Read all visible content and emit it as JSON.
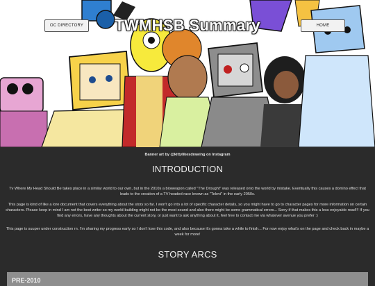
{
  "nav": {
    "oc_directory_label": "OC DIRECTORY",
    "home_label": "HOME"
  },
  "banner": {
    "title": "TWMHSB Summary",
    "credit": "Banner art by @kittylikesdrawing on Instagram"
  },
  "intro": {
    "heading": "INTRODUCTION",
    "paragraphs": [
      "Tv Where My Head Should Be takes place in a similar world to our own, but in the 2010s a bioweapon called \"The Drought\" was released onto the world by mistake. Eventually this causes a domino effect that leads to the creation of a TV headed race known as \"Televi\" in the early 2050s.",
      "This page is kind of like a lore document that covers everything about the story so far. I won't go into a lot of specific character details, so you might have to go to character pages for more information on certain characters. Please keep in mind I am not the best writer so my world-building might not be the most sound and also there might be some grammatical errors... Sorry if that makes this a less enjoyable read!!! If you find any errors, have any thoughts about the current story, or just want to ask anything about it, feel free to contact me via whatever avenue you prefer :)",
      "This page is suuper under construction rn. I'm sharing my progress early so I don't lose this code, and also because it's gonna take a while to finish... For now enjoy what's on the page and check back in maybe a week for more!"
    ]
  },
  "arcs": {
    "heading": "STORY ARCS",
    "first_arc_label": "PRE-2010"
  }
}
